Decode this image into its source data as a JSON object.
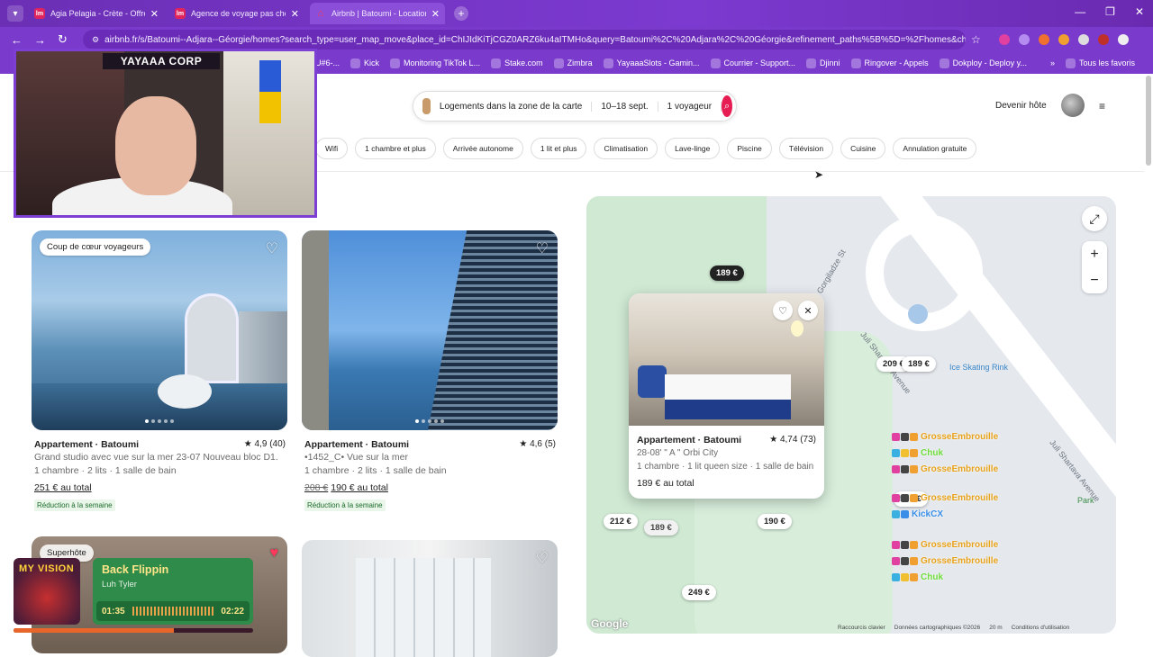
{
  "browser": {
    "tabs": [
      {
        "title": "Agia Pelagia - Crète - Offres de",
        "favicon": "lm",
        "active": false
      },
      {
        "title": "Agence de voyage pas chère | V",
        "favicon": "lm",
        "active": false
      },
      {
        "title": "Airbnb | Batoumi - Locations de",
        "favicon": "airbnb",
        "active": true
      }
    ],
    "url": "airbnb.fr/s/Batoumi--Adjara--Géorgie/homes?search_type=user_map_move&place_id=ChIJIdKiTjCGZ0ARZ6ku4aITMHo&query=Batoumi%2C%20Adjara%2C%20Géorgie&refinement_paths%5B%5D=%2Fhomes&checkin=2026-09-1...",
    "bookmarks": [
      "U#6-...",
      "Kick",
      "Monitoring TikTok L...",
      "Stake.com",
      "Zimbra",
      "YayaaaSlots - Gamin...",
      "Courrier - Support...",
      "Djinni",
      "Ringover - Appels",
      "Dokploy - Deploy y..."
    ],
    "all_bookmarks": "Tous les favoris"
  },
  "header": {
    "search_location": "Logements dans la zone de la carte",
    "search_dates": "10–18 sept.",
    "search_guests": "1 voyageur",
    "become_host": "Devenir hôte"
  },
  "filters": [
    "Wifi",
    "1 chambre et plus",
    "Arrivée autonome",
    "1 lit et plus",
    "Climatisation",
    "Lave-linge",
    "Piscine",
    "Télévision",
    "Cuisine",
    "Annulation gratuite"
  ],
  "stream": {
    "channel_title": "YAYAAA CORP"
  },
  "listings": [
    {
      "badge": "Coup de cœur voyageurs",
      "title": "Appartement · Batoumi",
      "rating": "★ 4,9 (40)",
      "desc": "Grand studio avec vue sur la mer 23-07 Nouveau bloc D1...",
      "beds": "1 chambre · 2 lits · 1 salle de bain",
      "old_price": "",
      "price": "251 € au total",
      "discount": "Réduction à la semaine"
    },
    {
      "badge": "",
      "title": "Appartement · Batoumi",
      "rating": "★ 4,6 (5)",
      "desc": "•1452_C• Vue sur la mer",
      "beds": "1 chambre · 2 lits · 1 salle de bain",
      "old_price": "208 €",
      "price": "190 € au total",
      "discount": "Réduction à la semaine"
    }
  ],
  "listing3_badge": "Superhôte",
  "map": {
    "streets": [
      "Zurab Gorgiladze St",
      "Juli Shartava Avenue",
      "Juli Shartava Avenue",
      "Ice Skating Rink",
      "Park"
    ],
    "pins": [
      "189 €",
      "209 €",
      "189 €",
      "212 €",
      "189 €",
      "190 €",
      "249 €",
      "505 €"
    ],
    "popup": {
      "title": "Appartement · Batoumi",
      "rating": "★ 4,74 (73)",
      "desc": "28-08' \" A \" Orbi City",
      "beds": "1 chambre · 1 lit queen size · 1 salle de bain",
      "price": "189 € au total"
    },
    "google": "Google",
    "attribution": [
      "Raccourcis clavier",
      "Données cartographiques ©2026",
      "20 m",
      "Conditions d'utilisation"
    ]
  },
  "chat": [
    {
      "user": "GrosseEmbrouille",
      "color": "#e8a21a"
    },
    {
      "user": "Chuk",
      "color": "#6fdc3a"
    },
    {
      "user": "GrosseEmbrouille",
      "color": "#e8a21a"
    },
    {
      "user": "GrosseEmbrouille",
      "color": "#e8a21a"
    },
    {
      "user": "KickCX",
      "color": "#3a8ee8"
    },
    {
      "user": "GrosseEmbrouille",
      "color": "#e8a21a"
    },
    {
      "user": "GrosseEmbrouille",
      "color": "#e8a21a"
    },
    {
      "user": "Chuk",
      "color": "#6fdc3a"
    }
  ],
  "music": {
    "album_text": "MY VISION",
    "song": "Back Flippin",
    "artist": "Luh Tyler",
    "elapsed": "01:35",
    "duration": "02:22",
    "progress": 0.67
  }
}
